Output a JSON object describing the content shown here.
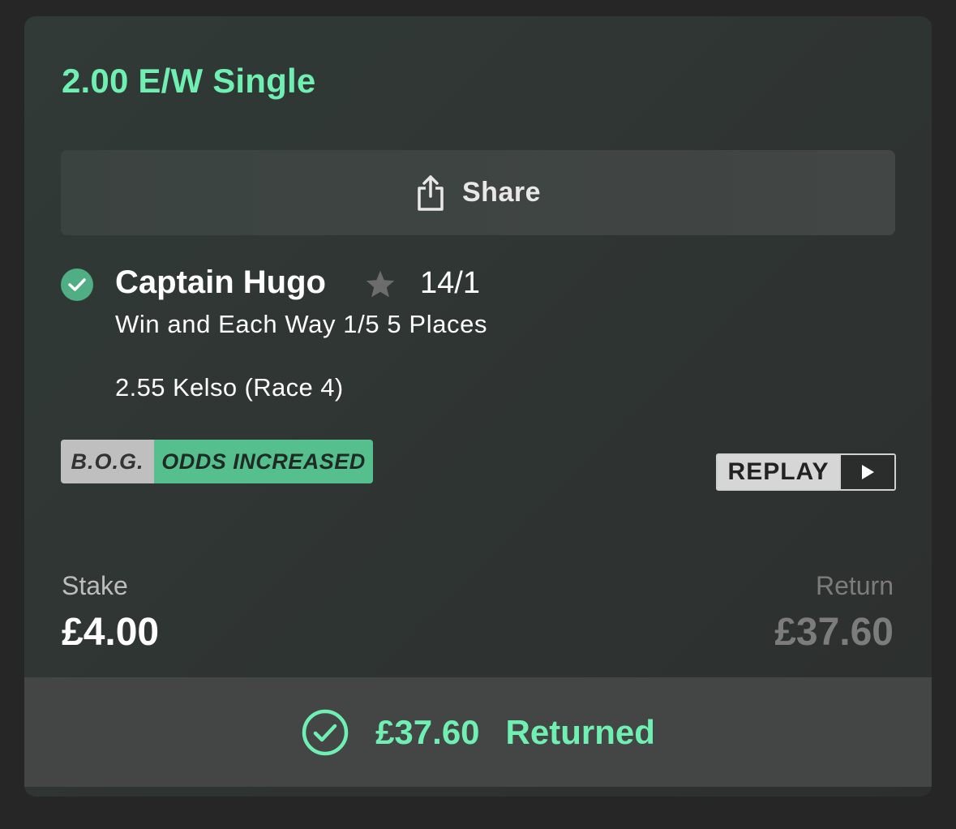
{
  "bet": {
    "title": "2.00 E/W Single"
  },
  "share": {
    "label": "Share",
    "icon": "share-icon"
  },
  "selection": {
    "status_icon": "check-icon",
    "name": "Captain Hugo",
    "favourite_icon": "star-icon",
    "odds": "14/1",
    "market": "Win and Each Way 1/5 5 Places",
    "event": "2.55 Kelso (Race 4)"
  },
  "badges": {
    "bog": "B.O.G.",
    "odds_increased": "ODDS INCREASED"
  },
  "replay": {
    "label": "REPLAY",
    "icon": "play-icon"
  },
  "stake": {
    "label": "Stake",
    "value": "£4.00"
  },
  "return": {
    "label": "Return",
    "value": "£37.60"
  },
  "returned": {
    "icon": "check-circle-icon",
    "amount": "£37.60",
    "text": "Returned"
  },
  "colors": {
    "accent": "#6ff0b2",
    "success_badge": "#55c08d",
    "background": "#262626"
  }
}
